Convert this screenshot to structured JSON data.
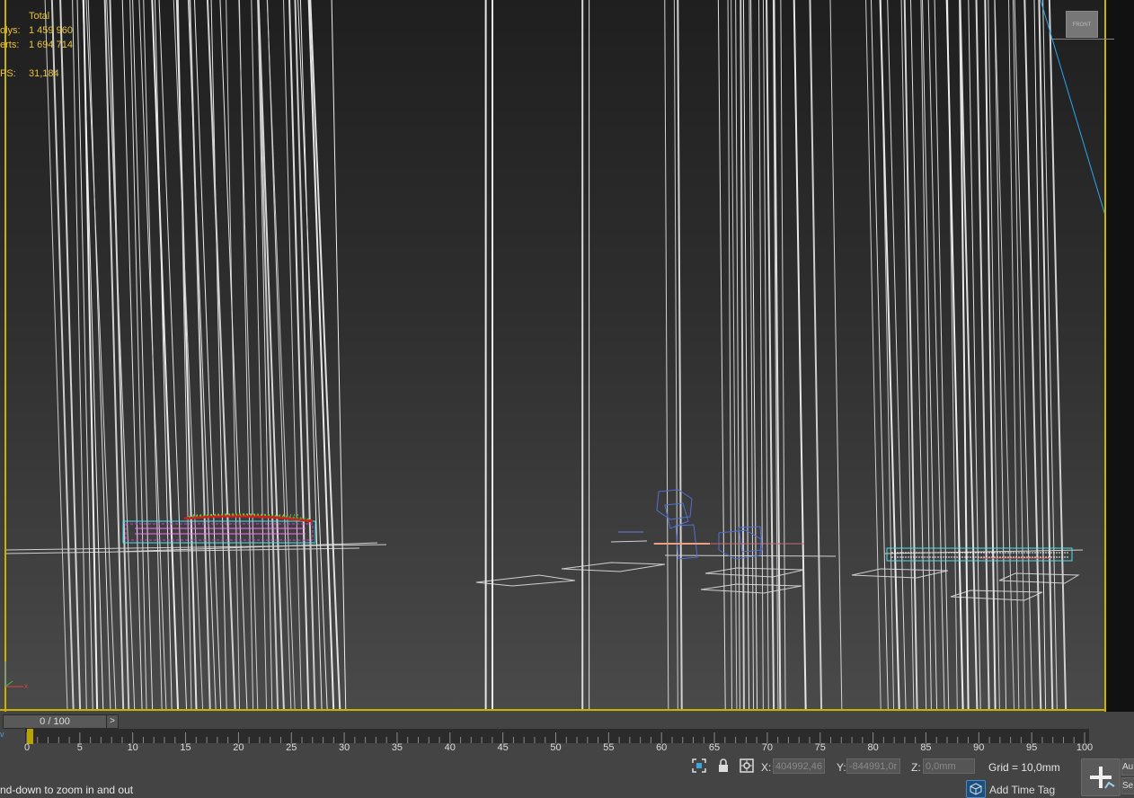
{
  "stats": {
    "header": "Total",
    "polys_label": "olys:",
    "polys_value": "1 459 960",
    "verts_label": "erts:",
    "verts_value": "1 694 714",
    "fps_label": "PS:",
    "fps_value": "31,184"
  },
  "viewcube": {
    "label": "FRONT"
  },
  "timeline": {
    "slider_label": "0 / 100",
    "next_label": ">",
    "left_marker": "v",
    "current_frame": 0,
    "range": [
      0,
      100
    ],
    "tick_labels": [
      "0",
      "5",
      "10",
      "15",
      "20",
      "25",
      "30",
      "35",
      "40",
      "45",
      "50",
      "55",
      "60",
      "65",
      "70",
      "75",
      "80",
      "85",
      "90",
      "95",
      "100"
    ]
  },
  "status": {
    "prompt": "nd-down to zoom in and out",
    "x_label": "X:",
    "x_value": "404992,46",
    "y_label": "Y:",
    "y_value": "-844991,0r",
    "z_label": "Z:",
    "z_value": "0,0mm",
    "grid_label": "Grid = 10,0mm",
    "time_tag_label": "Add Time Tag",
    "btn_au": "Au",
    "btn_se": "Se"
  },
  "colors": {
    "frame_active": "#c8b400",
    "stats_text": "#e8c43a",
    "wire_white": "#e0e0e0",
    "wire_cyan": "#48e0e8",
    "wire_magenta": "#d040d0",
    "wire_blue": "#5070d0",
    "axis_blue": "#2aa8f0"
  },
  "icons": {
    "zoom_extents": "zoom-extents-icon",
    "lock": "lock-icon",
    "absolute_mode": "absolute-mode-icon",
    "time_tag": "time-tag-icon",
    "add_key": "add-key-icon"
  }
}
